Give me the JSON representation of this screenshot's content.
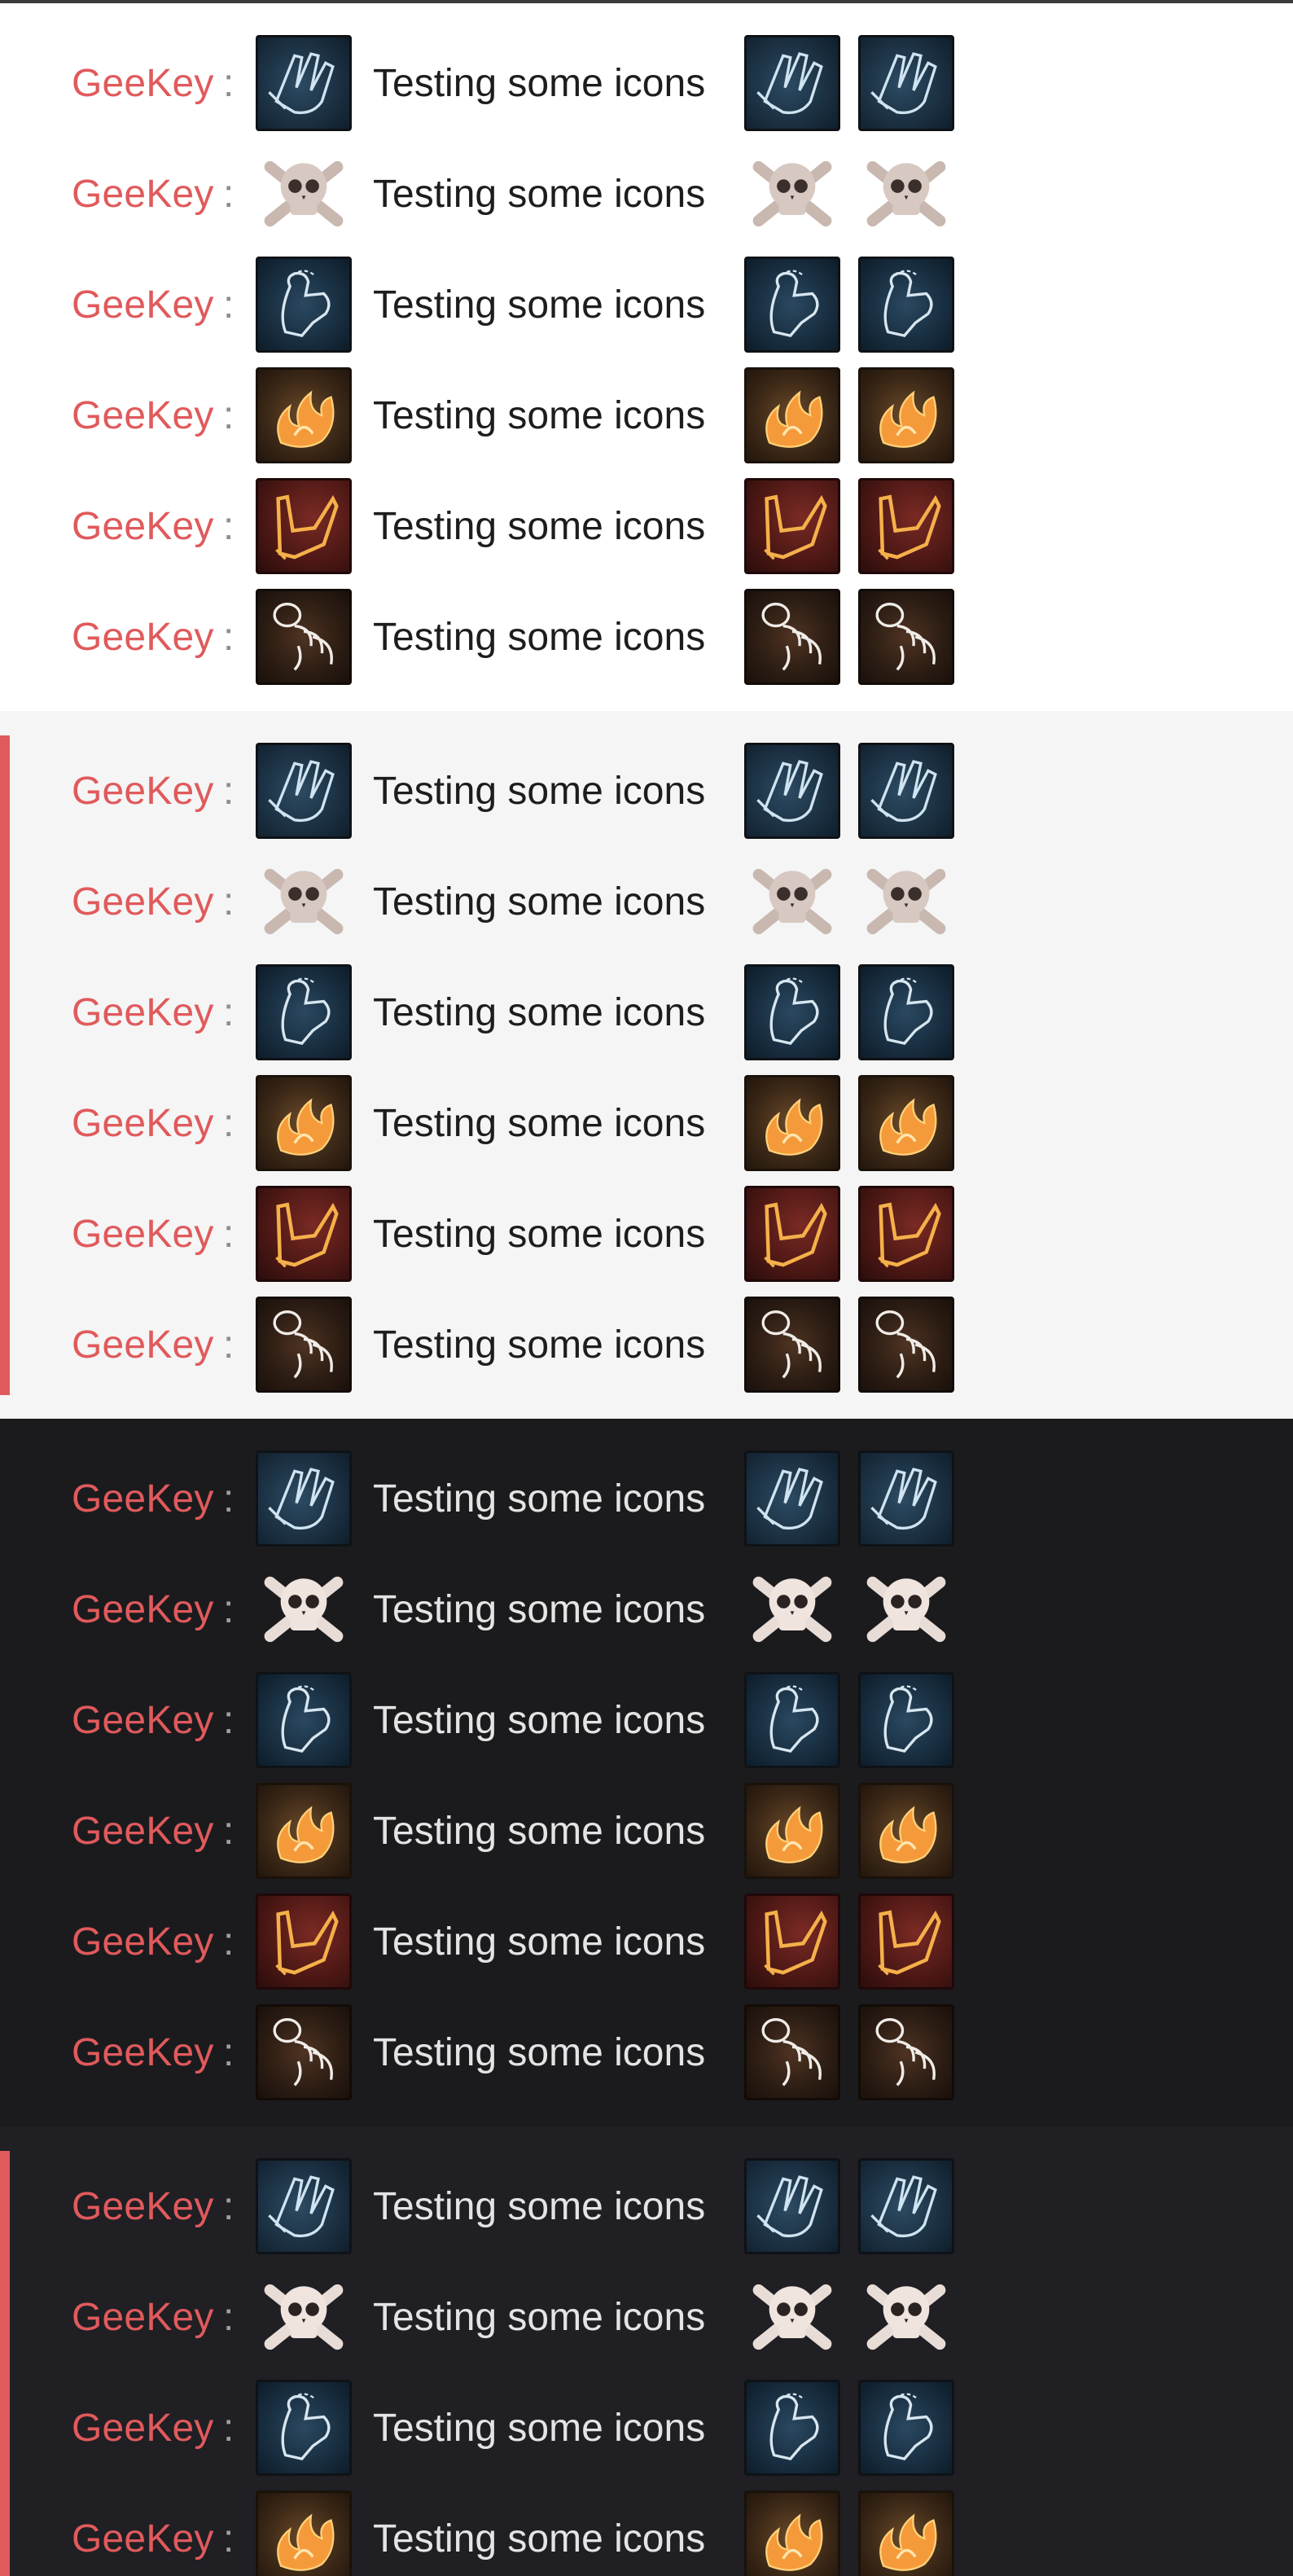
{
  "chat": {
    "sections": [
      {
        "theme": "white",
        "accent": false
      },
      {
        "theme": "light",
        "accent": true
      },
      {
        "theme": "dark",
        "accent": false
      },
      {
        "theme": "darker",
        "accent": true
      }
    ],
    "username": "GeeKey",
    "colon": ":",
    "message": "Testing some icons",
    "icons": [
      "hands-icon",
      "skull-icon",
      "muscle-icon",
      "fire-icon",
      "boot-icon",
      "claw-icon"
    ],
    "colors": {
      "username": "#e05a5c",
      "accent_bar": "#e05a5c",
      "white_bg": "#ffffff",
      "light_bg": "#f5f5f5",
      "dark_bg": "#1b1b1e",
      "darker_bg": "#1f1f24"
    }
  }
}
